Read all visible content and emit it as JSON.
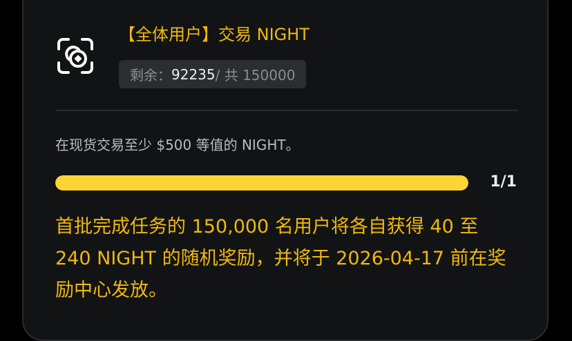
{
  "task": {
    "icon": "scan-coin-icon",
    "title": "【全体用户】交易 NIGHT",
    "remaining_label": "剩余：",
    "remaining_value": "92235",
    "total_text": " / 共 150000",
    "requirement": "在现货交易至少 $500 等值的 NIGHT。",
    "progress": {
      "fraction": 1.0,
      "label": "1/1"
    },
    "reward_text": "首批完成任务的 150,000 名用户将各自获得 40 至 240 NIGHT 的随机奖励，并将于 2026-04-17 前在奖励中心发放。"
  },
  "colors": {
    "accent": "#f0b90b",
    "progress_fill": "#fcd535",
    "card_bg": "#121315",
    "badge_bg": "#2b2d31"
  }
}
